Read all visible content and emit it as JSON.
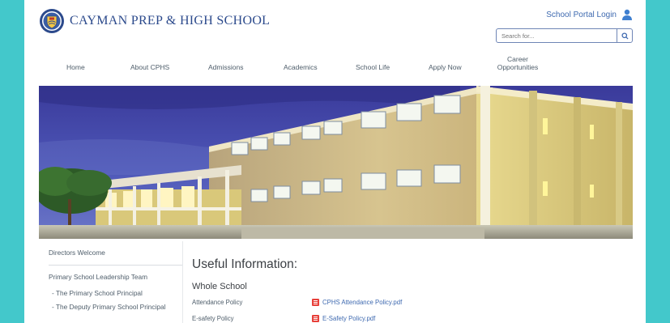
{
  "header": {
    "brand": "CAYMAN PREP & HIGH SCHOOL",
    "portal_label": "School Portal Login",
    "search_placeholder": "Search for..."
  },
  "nav": [
    {
      "label": "Home"
    },
    {
      "label": "About CPHS"
    },
    {
      "label": "Admissions"
    },
    {
      "label": "Academics"
    },
    {
      "label": "School Life"
    },
    {
      "label": "Apply Now"
    },
    {
      "label": "Career Opportunities"
    }
  ],
  "sidebar": [
    {
      "label": "Directors Welcome"
    },
    {
      "label": "Primary School Leadership Team"
    },
    {
      "label": "- The Primary School Principal"
    },
    {
      "label": "- The Deputy Primary School Principal"
    }
  ],
  "main": {
    "title": "Useful Information:",
    "section": "Whole School",
    "rows": [
      {
        "label": "Attendance Policy",
        "file": "CPHS Attendance Policy.pdf"
      },
      {
        "label": "E-safety Policy",
        "file": "E-Safety Policy.pdf"
      }
    ]
  },
  "colors": {
    "frame": "#43c8cb",
    "brand_blue": "#2c4a8c",
    "link_blue": "#3f6ab0",
    "pdf_red": "#e7403a"
  }
}
